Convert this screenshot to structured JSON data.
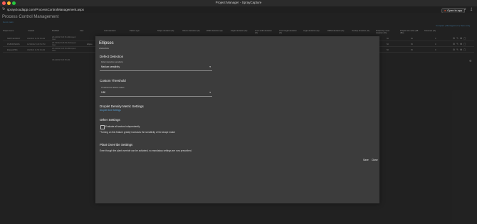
{
  "window": {
    "title": "Project Manager - SprayCapture",
    "url": "spraycloudapp.com/ProcessControlManagement.aspx",
    "open_in_app": "Open in app"
  },
  "page": {
    "title": "Process Control Management",
    "back_link": "Go to main",
    "top_actions": "Compare | Management | New entry"
  },
  "table": {
    "headers": [
      "Project name",
      "Created",
      "Modified",
      "User",
      "Gold standard",
      "Pattern type",
      "Shape deviation (%)",
      "Volume deviation (%)",
      "Width deviation (%)",
      "Height deviation (%)",
      "Inner width deviation (%)",
      "Inner height deviation (%)",
      "Angle deviation (%)",
      "RMSE deviation (%)",
      "Overlap deviation (%)",
      "Droplet by count deviation (%)",
      "Droplet size value (dB dBs)",
      "Tolerance (%)"
    ],
    "rows": [
      {
        "name": "SKPP Ell PROT",
        "created": "3/3/2022 11:53:34 AM",
        "modified": "2/11/2022 8:26:51 AM Expert User",
        "v1": "50",
        "v2": "50",
        "v3": "0"
      },
      {
        "name": "PGB RONDOS",
        "created": "1/23/2022 6:29:51 PM",
        "modified": "2/17/2022 8:26:53 AM Expert User",
        "v1": "50",
        "v2": "50",
        "v3": "0"
      },
      {
        "name": "Elipses/PRG",
        "created": "3/3/2022 11:53:34 AM",
        "modified": "2/11/2022 8:26:53 AM Expert User",
        "v1": "50",
        "v2": "50",
        "v3": "0"
      }
    ],
    "gold_marker": "Ellipse",
    "summary_date": "3/11/2022 8:26:53 AM"
  },
  "modal": {
    "title": "Ellipses",
    "subtitle": "ASM-PRG",
    "defect": {
      "heading": "Defect Detection",
      "label": "Defect detection sensitivity",
      "value": "Medium sensitivity"
    },
    "threshold": {
      "heading": "Custom Threshold",
      "label": "Threshold for defects values",
      "value": "0.80"
    },
    "density": {
      "heading": "Droplet Density Metric Settings",
      "link": "Droplet Size Settings"
    },
    "other": {
      "heading": "Other Settings",
      "checkbox_label": "Evaluate all sectors independently",
      "note": "*Turning on this feature greatly increases the sensitivity of the shape match"
    },
    "plant": {
      "heading": "Plant Override Settings",
      "text": "Even though the plant override can be activated, no mandatory settings are now prescribed."
    },
    "save": "Save",
    "close": "Close"
  }
}
